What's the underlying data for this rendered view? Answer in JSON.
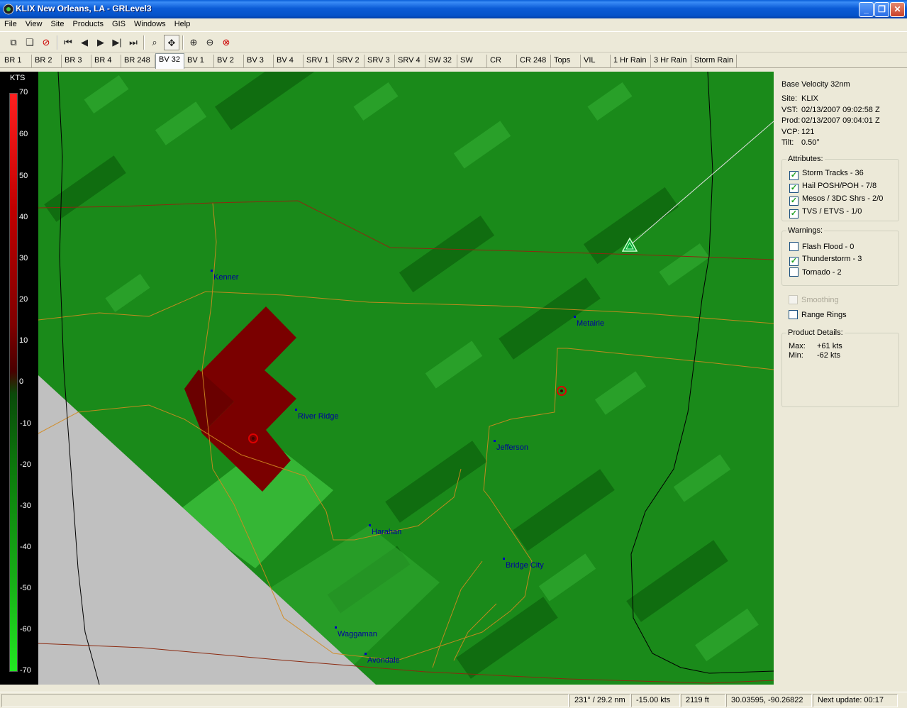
{
  "window": {
    "title": "KLIX New Orleans, LA - GRLevel3"
  },
  "menu": [
    "File",
    "View",
    "Site",
    "Products",
    "GIS",
    "Windows",
    "Help"
  ],
  "toolbar": {
    "icons": [
      "copy-icon",
      "copy-all-icon",
      "cancel-icon",
      "first-frame-icon",
      "step-back-icon",
      "play-icon",
      "step-forward-icon",
      "last-frame-icon",
      "zoom-icon",
      "pan-icon",
      "zoom-in-icon",
      "zoom-out-icon",
      "zoom-reset-icon"
    ]
  },
  "tabs": [
    "BR 1",
    "BR 2",
    "BR 3",
    "BR 4",
    "BR 248",
    "BV 32",
    "BV 1",
    "BV 2",
    "BV 3",
    "BV 4",
    "SRV 1",
    "SRV 2",
    "SRV 3",
    "SRV 4",
    "SW 32",
    "SW",
    "CR",
    "CR 248",
    "Tops",
    "VIL",
    "1 Hr Rain",
    "3 Hr Rain",
    "Storm Rain"
  ],
  "active_tab": "BV 32",
  "legend": {
    "units": "KTS",
    "ticks": [
      "70",
      "60",
      "50",
      "40",
      "30",
      "20",
      "10",
      "0",
      "-10",
      "-20",
      "-30",
      "-40",
      "-50",
      "-60",
      "-70"
    ]
  },
  "map": {
    "cities": [
      "Kenner",
      "Metairie",
      "River Ridge",
      "Jefferson",
      "Harahan",
      "Bridge City",
      "Waggaman",
      "Avondale"
    ],
    "colors": {
      "background": "#1a8a1a",
      "inbound_high": "#7a0000",
      "outside_range": "#c0c0c0"
    }
  },
  "panel": {
    "product": "Base Velocity 32nm",
    "site_label": "Site:",
    "site": "KLIX",
    "vst_label": "VST:",
    "vst": "02/13/2007  09:02:58 Z",
    "prod_label": "Prod:",
    "prod": "02/13/2007  09:04:01 Z",
    "vcp_label": "VCP:",
    "vcp": "121",
    "tilt_label": "Tilt:",
    "tilt": "0.50°",
    "attributes": {
      "title": "Attributes:",
      "items": [
        {
          "label": "Storm Tracks - 36",
          "checked": true
        },
        {
          "label": "Hail POSH/POH - 7/8",
          "checked": true
        },
        {
          "label": "Mesos / 3DC Shrs - 2/0",
          "checked": true
        },
        {
          "label": "TVS / ETVS - 1/0",
          "checked": true
        }
      ]
    },
    "warnings": {
      "title": "Warnings:",
      "items": [
        {
          "label": "Flash Flood - 0",
          "checked": false
        },
        {
          "label": "Thunderstorm - 3",
          "checked": true
        },
        {
          "label": "Tornado - 2",
          "checked": false
        }
      ]
    },
    "smoothing": "Smoothing",
    "range_rings": "Range Rings",
    "details": {
      "title": "Product Details:",
      "max_label": "Max:",
      "max": "+61 kts",
      "min_label": "Min:",
      "min": "-62 kts"
    }
  },
  "status": {
    "azimuth": "231° / 29.2 nm",
    "velocity": "-15.00 kts",
    "height": "2119 ft",
    "coords": "30.03595, -90.26822",
    "next_update": "Next update: 00:17"
  }
}
